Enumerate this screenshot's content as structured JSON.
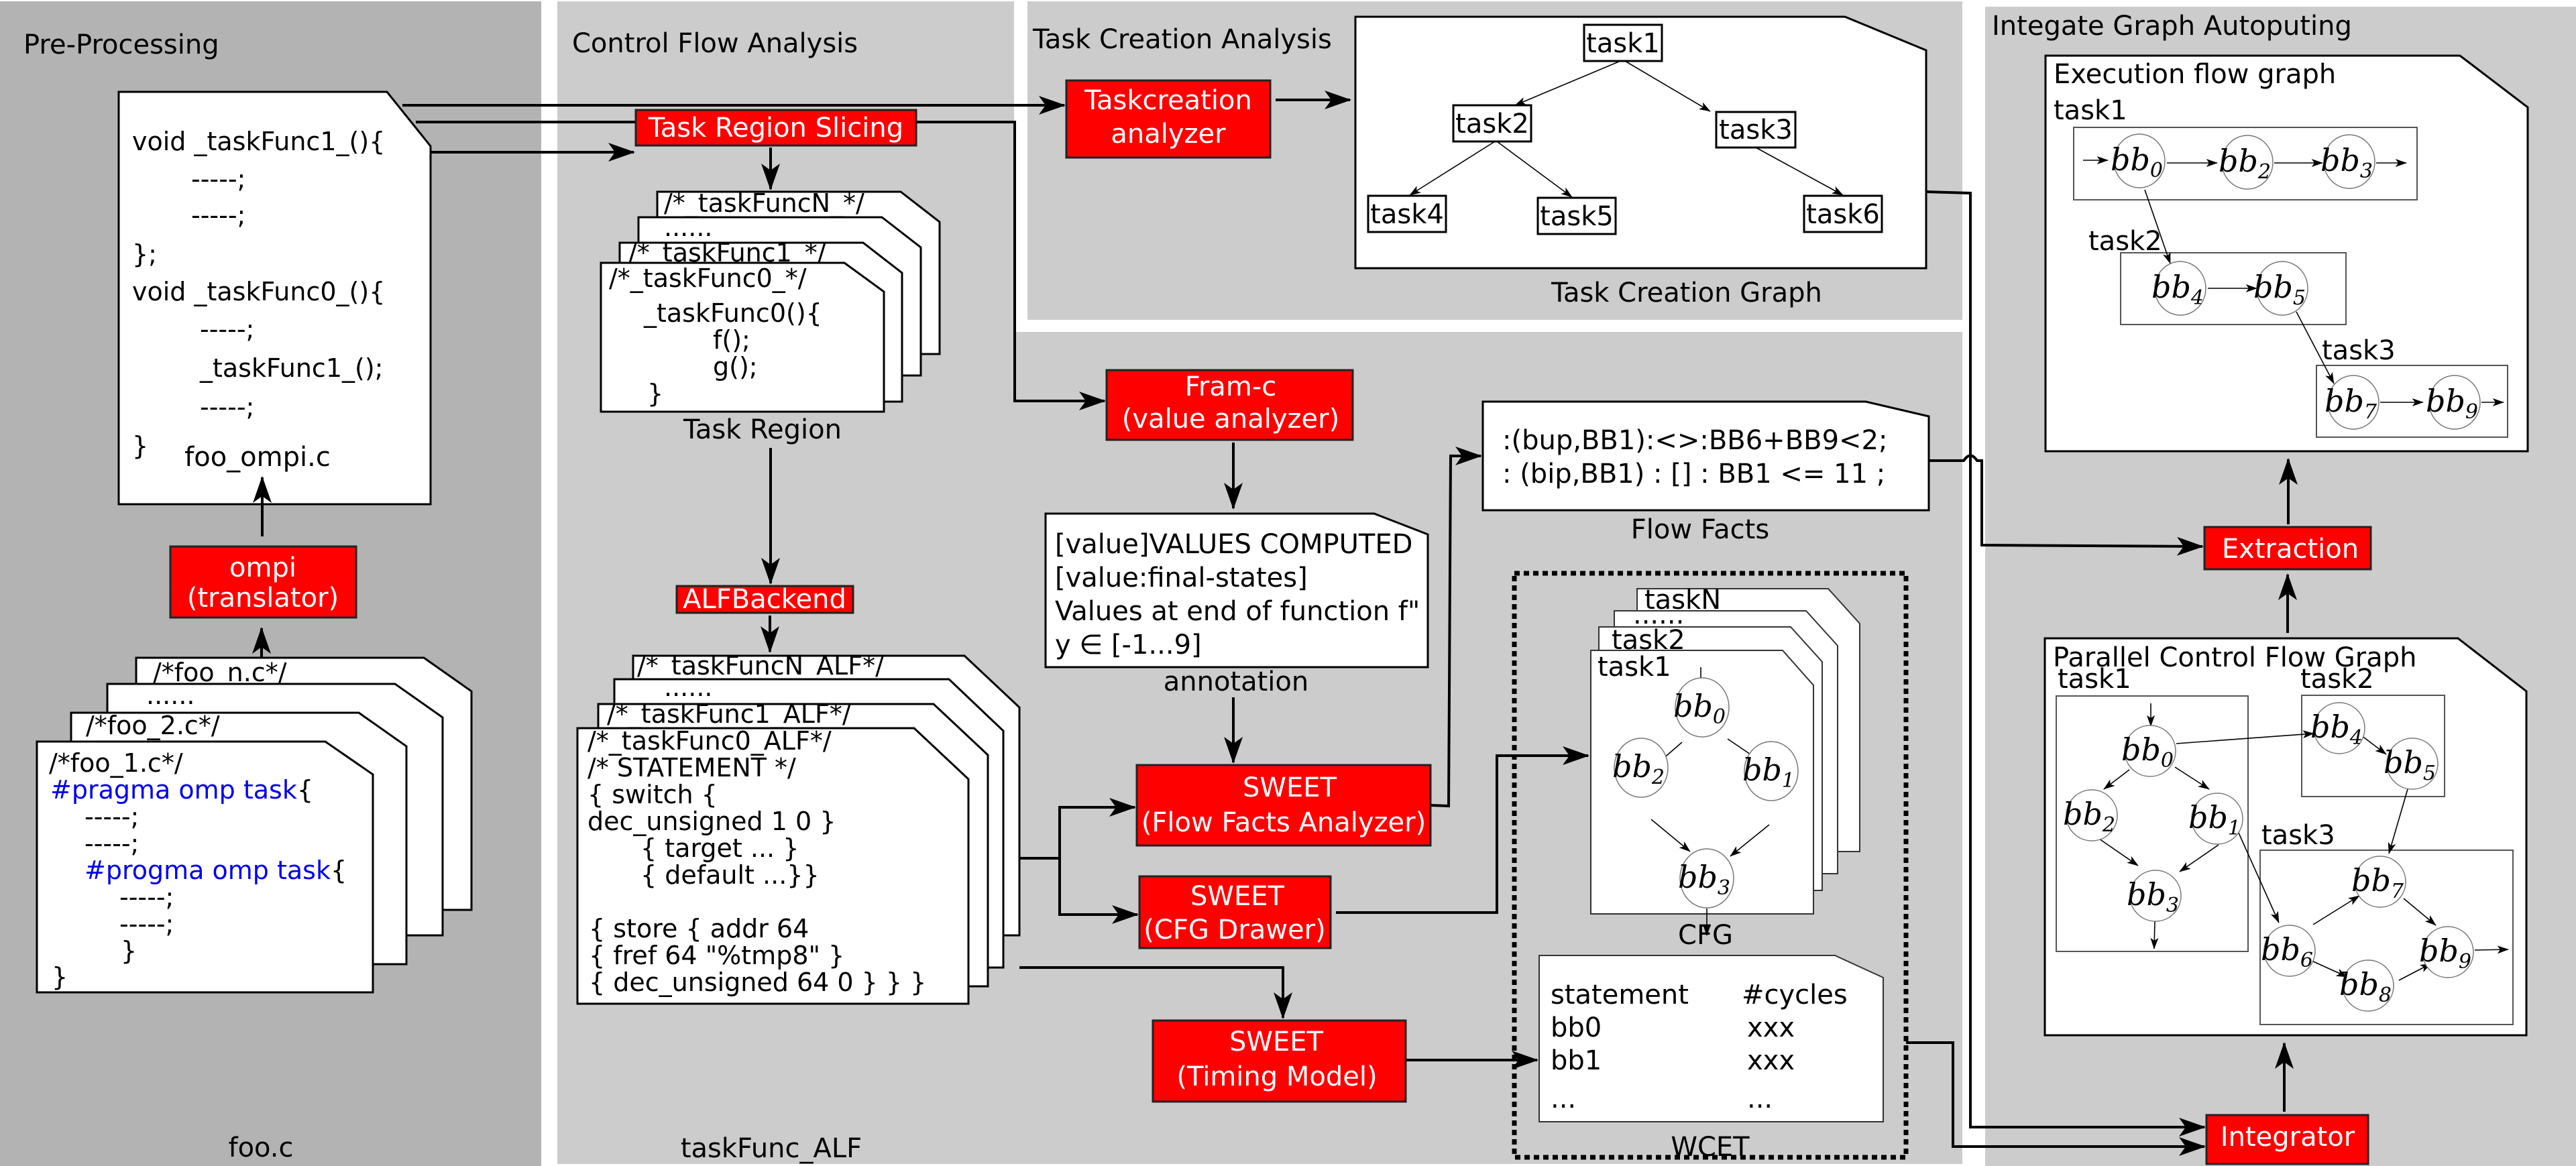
{
  "panels": {
    "preprocessing": {
      "title": "Pre-Processing",
      "bg": "#b3b3b3"
    },
    "control_flow": {
      "title": "Control Flow Analysis",
      "bg": "#cccccc"
    },
    "task_creation": {
      "title": "Task Creation Analysis",
      "bg": "#cccccc"
    },
    "integrate": {
      "title": "Integate Graph Autoputing",
      "bg": "#cccccc"
    }
  },
  "colors": {
    "process_box": "#ff0000",
    "process_text": "#ffffff",
    "pragma": "#0000ee"
  },
  "foo_ompi": {
    "label": "foo_ompi.c",
    "lines": [
      "void _taskFunc1_(){",
      "-----;",
      "-----;",
      "};",
      "void _taskFunc0_(){",
      "-----;",
      "_taskFunc1_();",
      "-----;",
      "}"
    ]
  },
  "ompi_box": {
    "line1": "ompi",
    "line2": "(translator)"
  },
  "foo_files": {
    "label": "foo.c",
    "sheets": [
      "/*foo_n.c*/",
      "......",
      "/*foo_2.c*/"
    ],
    "front_title": "/*foo_1.c*/",
    "front_lines": [
      {
        "text": "#pragma omp task",
        "suffix": "{"
      },
      {
        "text": "-----;"
      },
      {
        "text": "-----;"
      },
      {
        "text": "#progma omp task",
        "suffix": "{"
      },
      {
        "text": "-----;"
      },
      {
        "text": "-----;"
      },
      {
        "text": "}"
      },
      {
        "text": "}"
      }
    ]
  },
  "task_region_slicing": {
    "label": "Task Region Slicing"
  },
  "task_region": {
    "label": "Task Region",
    "sheets": [
      "/*_taskFuncN_*/",
      "......",
      "/*_taskFunc1_*/"
    ],
    "front_title": "/*_taskFunc0_*/",
    "front_lines": [
      "_taskFunc0(){",
      "f();",
      "g();",
      "}"
    ]
  },
  "alf_backend": {
    "label": "ALFBackend"
  },
  "task_func_alf": {
    "label": "taskFunc_ALF",
    "sheets": [
      "/*_taskFuncN_ALF*/",
      "......",
      "/*_taskFunc1_ALF*/"
    ],
    "front_title": "/*_taskFunc0_ALF*/",
    "front_lines": [
      "/* STATEMENT */",
      "{ switch {",
      "dec_unsigned 1 0 }",
      "{ target ... }",
      "{ default  ...}}",
      "",
      "{ store { addr 64",
      "{ fref 64 \"%tmp8\" }",
      "{ dec_unsigned 64 0 } } }"
    ]
  },
  "taskcreation_analyzer": {
    "line1": "Taskcreation",
    "line2": "analyzer"
  },
  "task_creation_graph": {
    "label": "Task Creation Graph",
    "nodes": [
      "task1",
      "task2",
      "task3",
      "task4",
      "task5",
      "task6"
    ],
    "edges": [
      [
        "task1",
        "task2"
      ],
      [
        "task1",
        "task3"
      ],
      [
        "task2",
        "task4"
      ],
      [
        "task2",
        "task5"
      ],
      [
        "task3",
        "task6"
      ]
    ]
  },
  "framc": {
    "line1": "Fram-c",
    "line2": "(value analyzer)"
  },
  "annotation": {
    "label": "annotation",
    "lines": [
      "[value]VALUES COMPUTED",
      "[value:final-states]",
      "Values at end of function f\"",
      "y ∈ [-1...9]"
    ]
  },
  "flow_facts": {
    "label": "Flow Facts",
    "lines": [
      ":(bup,BB1):<>:BB6+BB9<2;",
      ": (bip,BB1) : [] : BB1 <= 11 ;"
    ]
  },
  "sweet_ff": {
    "line1": "SWEET",
    "line2": "(Flow Facts Analyzer)"
  },
  "sweet_cfg": {
    "line1": "SWEET",
    "line2": "(CFG Drawer)"
  },
  "sweet_timing": {
    "line1": "SWEET",
    "line2": "(Timing Model)"
  },
  "cfg": {
    "label": "CFG",
    "sheets": [
      "taskN",
      "......",
      "task2"
    ],
    "front_title": "task1",
    "nodes": [
      {
        "b": "bb",
        "s": "0"
      },
      {
        "b": "bb",
        "s": "2"
      },
      {
        "b": "bb",
        "s": "1"
      },
      {
        "b": "bb",
        "s": "3"
      }
    ]
  },
  "wcet": {
    "label": "WCET",
    "headers": [
      "statement",
      "#cycles"
    ],
    "rows": [
      [
        "bb0",
        "xxx"
      ],
      [
        "bb1",
        "xxx"
      ],
      [
        "...",
        "..."
      ]
    ]
  },
  "execution_flow_graph": {
    "title": "Execution flow graph",
    "groups": [
      {
        "label": "task1",
        "nodes": [
          {
            "b": "bb",
            "s": "0"
          },
          {
            "b": "bb",
            "s": "2"
          },
          {
            "b": "bb",
            "s": "3"
          }
        ]
      },
      {
        "label": "task2",
        "nodes": [
          {
            "b": "bb",
            "s": "4"
          },
          {
            "b": "bb",
            "s": "5"
          }
        ]
      },
      {
        "label": "task3",
        "nodes": [
          {
            "b": "bb",
            "s": "7"
          },
          {
            "b": "bb",
            "s": "9"
          }
        ]
      }
    ]
  },
  "extraction": {
    "label": "Extraction"
  },
  "parallel_cfg": {
    "title": "Parallel Control Flow Graph",
    "groups": [
      {
        "label": "task1",
        "nodes": [
          {
            "b": "bb",
            "s": "0"
          },
          {
            "b": "bb",
            "s": "2"
          },
          {
            "b": "bb",
            "s": "1"
          },
          {
            "b": "bb",
            "s": "3"
          }
        ]
      },
      {
        "label": "task2",
        "nodes": [
          {
            "b": "bb",
            "s": "4"
          },
          {
            "b": "bb",
            "s": "5"
          }
        ]
      },
      {
        "label": "task3",
        "nodes": [
          {
            "b": "bb",
            "s": "7"
          },
          {
            "b": "bb",
            "s": "6"
          },
          {
            "b": "bb",
            "s": "9"
          },
          {
            "b": "bb",
            "s": "8"
          }
        ]
      }
    ]
  },
  "integrator": {
    "label": "Integrator"
  }
}
